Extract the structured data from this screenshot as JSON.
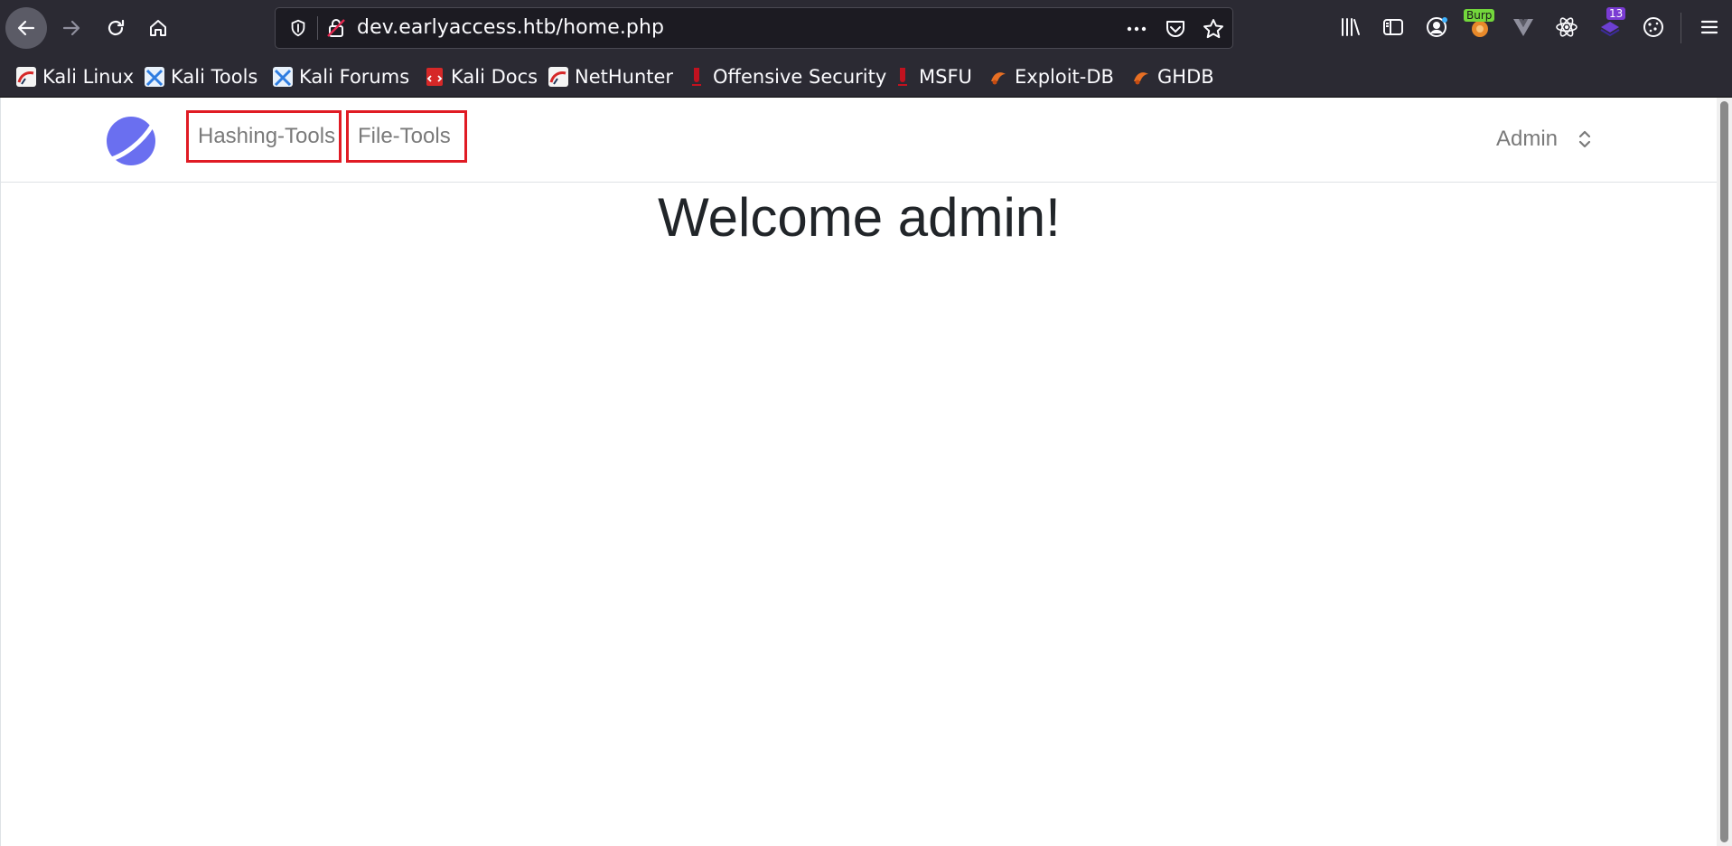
{
  "browser": {
    "url": "dev.earlyaccess.htb/home.php",
    "extensions": {
      "burp_badge": "Burp",
      "notification_count": "13"
    },
    "bookmarks": [
      {
        "label": "Kali Linux",
        "icon": "kali-icon"
      },
      {
        "label": "Kali Tools",
        "icon": "kali-tools-icon"
      },
      {
        "label": "Kali Forums",
        "icon": "kali-forums-icon"
      },
      {
        "label": "Kali Docs",
        "icon": "kali-docs-icon"
      },
      {
        "label": "NetHunter",
        "icon": "nethunter-icon"
      },
      {
        "label": "Offensive Security",
        "icon": "offsec-icon"
      },
      {
        "label": "MSFU",
        "icon": "msfu-icon"
      },
      {
        "label": "Exploit-DB",
        "icon": "exploit-db-icon"
      },
      {
        "label": "GHDB",
        "icon": "ghdb-icon"
      }
    ]
  },
  "page": {
    "nav": {
      "items": [
        {
          "label": "Hashing-Tools"
        },
        {
          "label": "File-Tools"
        }
      ],
      "user_label": "Admin"
    },
    "welcome_heading": "Welcome admin!"
  },
  "colors": {
    "chrome_bg": "#2b2a33",
    "highlight_box": "#e01b24",
    "logo": "#6a6ff0",
    "nav_text": "#7a7a7a"
  }
}
